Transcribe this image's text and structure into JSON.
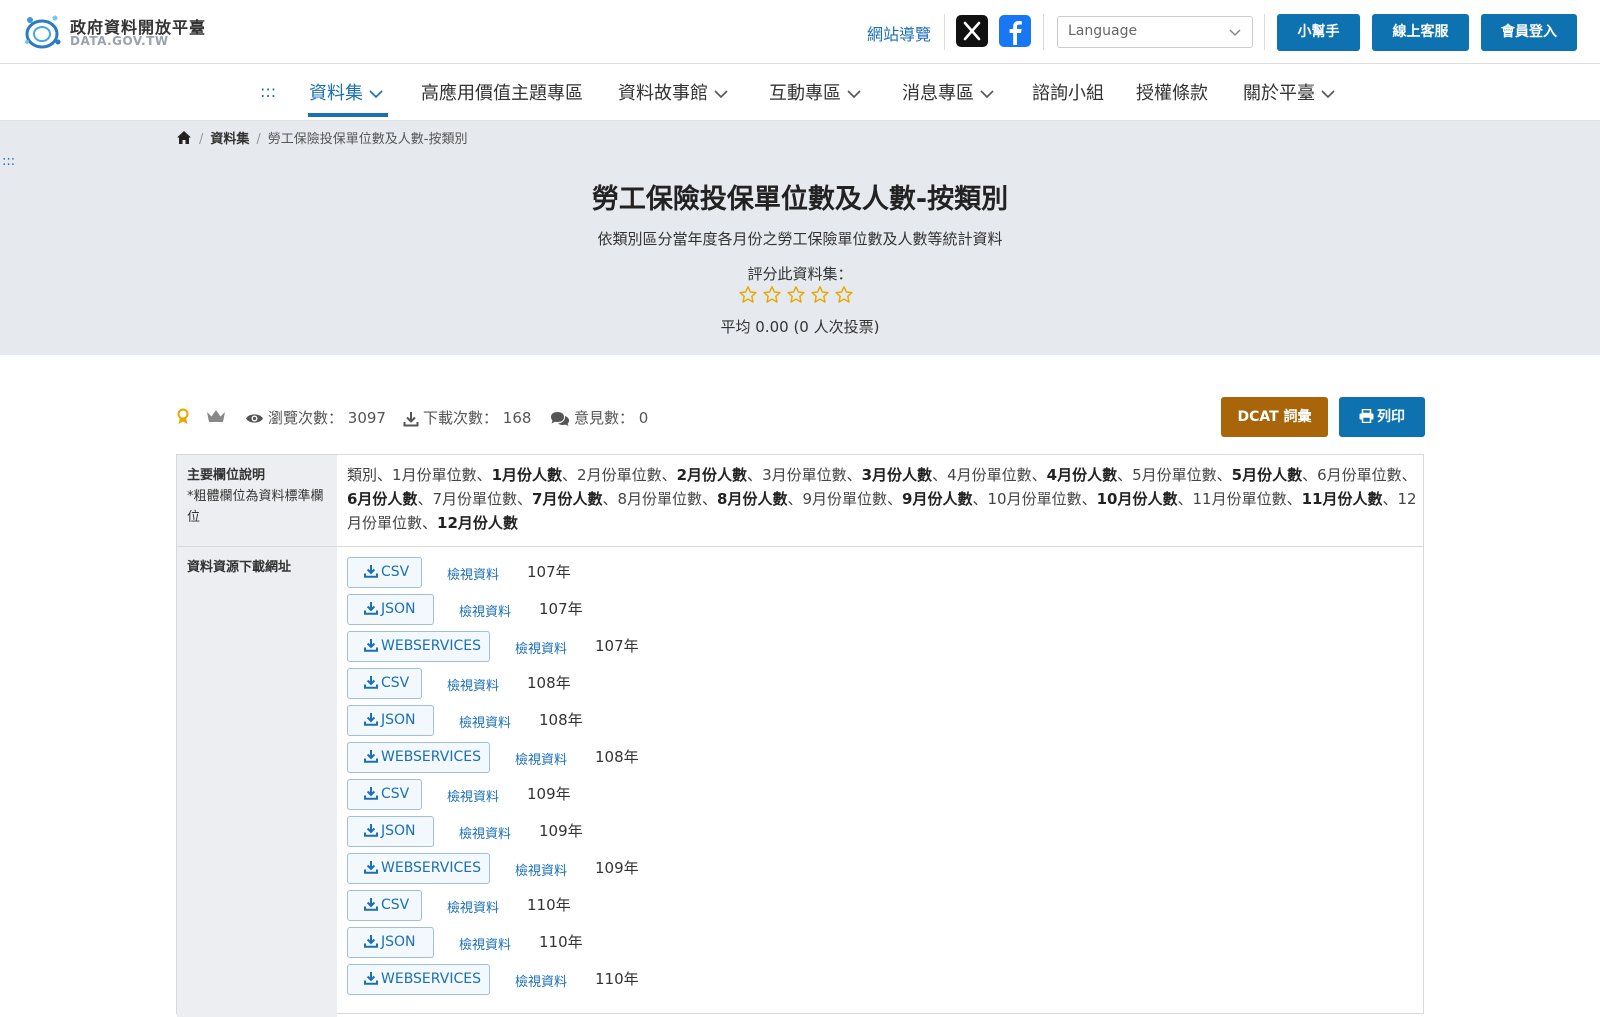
{
  "header": {
    "logo_title": "政府資料開放平臺",
    "logo_sub": "DATA.GOV.TW",
    "sitemap": "網站導覽",
    "language_placeholder": "Language",
    "buttons": {
      "help": "小幫手",
      "service": "線上客服",
      "login": "會員登入"
    }
  },
  "nav": {
    "accesskey": ":::",
    "items": [
      "資料集",
      "高應用價值主題專區",
      "資料故事館",
      "互動專區",
      "消息專區",
      "諮詢小組",
      "授權條款",
      "關於平臺"
    ]
  },
  "breadcrumb": {
    "home": "home",
    "section": "資料集",
    "current": "勞工保險投保單位數及人數-按類別"
  },
  "side_accesskey": ":::",
  "dataset": {
    "title": "勞工保險投保單位數及人數-按類別",
    "description": "依類別區分當年度各月份之勞工保險單位數及人數等統計資料",
    "rating_label": "評分此資料集：",
    "rating_stars": 0,
    "rating_max": 5,
    "rating_avg": "平均 0.00 (0 人次投票)"
  },
  "stats": {
    "views_label": "瀏覽次數：",
    "views": "3097",
    "downloads_label": "下載次數：",
    "downloads": "168",
    "comments_label": "意見數：",
    "comments": "0",
    "dcat_button": "DCAT 詞彙",
    "print_button": "列印"
  },
  "fields_section": {
    "label": "主要欄位說明",
    "note": "*粗體欄位為資料標準欄位",
    "fields": [
      {
        "t": "類別",
        "b": false
      },
      {
        "t": "1月份單位數",
        "b": false
      },
      {
        "t": "1月份人數",
        "b": true
      },
      {
        "t": "2月份單位數",
        "b": false
      },
      {
        "t": "2月份人數",
        "b": true
      },
      {
        "t": "3月份單位數",
        "b": false
      },
      {
        "t": "3月份人數",
        "b": true
      },
      {
        "t": "4月份單位數",
        "b": false
      },
      {
        "t": "4月份人數",
        "b": true
      },
      {
        "t": "5月份單位數",
        "b": false
      },
      {
        "t": "5月份人數",
        "b": true
      },
      {
        "t": "6月份單位數",
        "b": false
      },
      {
        "t": "6月份人數",
        "b": true
      },
      {
        "t": "7月份單位數",
        "b": false
      },
      {
        "t": "7月份人數",
        "b": true
      },
      {
        "t": "8月份單位數",
        "b": false
      },
      {
        "t": "8月份人數",
        "b": true
      },
      {
        "t": "9月份單位數",
        "b": false
      },
      {
        "t": "9月份人數",
        "b": true
      },
      {
        "t": "10月份單位數",
        "b": false
      },
      {
        "t": "10月份人數",
        "b": true
      },
      {
        "t": "11月份單位數",
        "b": false
      },
      {
        "t": "11月份人數",
        "b": true
      },
      {
        "t": "12月份單位數",
        "b": false
      },
      {
        "t": "12月份人數",
        "b": true
      }
    ]
  },
  "resources_section": {
    "label": "資料資源下載網址",
    "view_label": "檢視資料",
    "items": [
      {
        "format": "CSV",
        "year": "107年"
      },
      {
        "format": "JSON",
        "year": "107年"
      },
      {
        "format": "WEBSERVICES",
        "year": "107年"
      },
      {
        "format": "CSV",
        "year": "108年"
      },
      {
        "format": "JSON",
        "year": "108年"
      },
      {
        "format": "WEBSERVICES",
        "year": "108年"
      },
      {
        "format": "CSV",
        "year": "109年"
      },
      {
        "format": "JSON",
        "year": "109年"
      },
      {
        "format": "WEBSERVICES",
        "year": "109年"
      },
      {
        "format": "CSV",
        "year": "110年"
      },
      {
        "format": "JSON",
        "year": "110年"
      },
      {
        "format": "WEBSERVICES",
        "year": "110年"
      }
    ]
  },
  "colors": {
    "primary": "#0e72b0",
    "dcat": "#a8650a",
    "hero_bg": "#e6e9ee",
    "star": "#e5a800"
  }
}
